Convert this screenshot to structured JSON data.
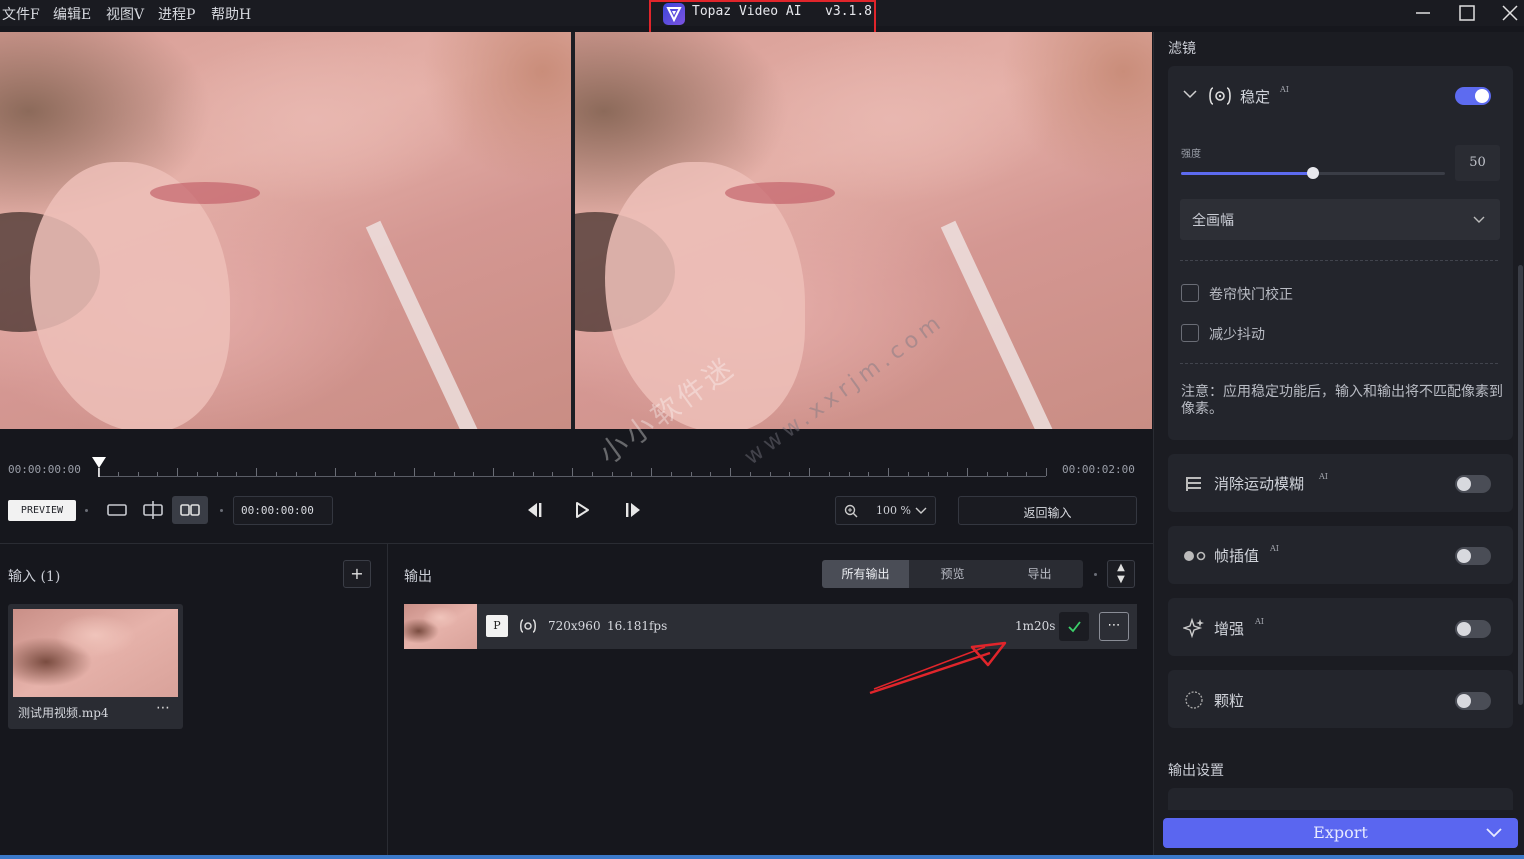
{
  "menu": {
    "items": [
      "文件F",
      "编辑E",
      "视图V",
      "进程P",
      "帮助H"
    ]
  },
  "app": {
    "title": "Topaz Video AI   v3.1.8"
  },
  "timeline": {
    "start_time": "00:00:00:00",
    "end_time": "00:00:02:00",
    "preview_label": "PREVIEW",
    "current_time": "00:00:00:00",
    "zoom": "100 %",
    "return_input_label": "返回输入"
  },
  "input_panel": {
    "title": "输入 (1)",
    "file_name": "测试用视频.mp4"
  },
  "output_panel": {
    "title": "输出",
    "tabs": [
      "所有输出",
      "预览",
      "导出"
    ],
    "row": {
      "badge": "P",
      "resolution": "720x960",
      "fps": "16.181fps",
      "duration": "1m20s"
    }
  },
  "filters": {
    "title": "滤镜",
    "stabilize": {
      "label": "稳定",
      "ai": "AI",
      "enabled": true,
      "strength_label": "强度",
      "strength_value": "50",
      "strength_fraction": 0.5,
      "mode": "全画幅",
      "rolling_shutter": "卷帘快门校正",
      "reduce_jitter": "减少抖动",
      "note": "注意：应用稳定功能后，输入和输出将不匹配像素到像素。"
    },
    "motion_deblur": {
      "label": "消除运动模糊",
      "ai": "AI",
      "enabled": false
    },
    "frame_interp": {
      "label": "帧插值",
      "ai": "AI",
      "enabled": false
    },
    "enhance": {
      "label": "增强",
      "ai": "AI",
      "enabled": false
    },
    "grain": {
      "label": "颗粒",
      "enabled": false
    }
  },
  "output_settings": {
    "title": "输出设置"
  },
  "export": {
    "label": "Export"
  },
  "watermark": {
    "text_cn": "小小软件迷",
    "text_url": "www.xxrjm.com"
  },
  "colors": {
    "accent": "#5d6bf0",
    "export_button": "#5a66f0",
    "highlight_box": "#e0252b",
    "arrow": "#e0252b"
  }
}
